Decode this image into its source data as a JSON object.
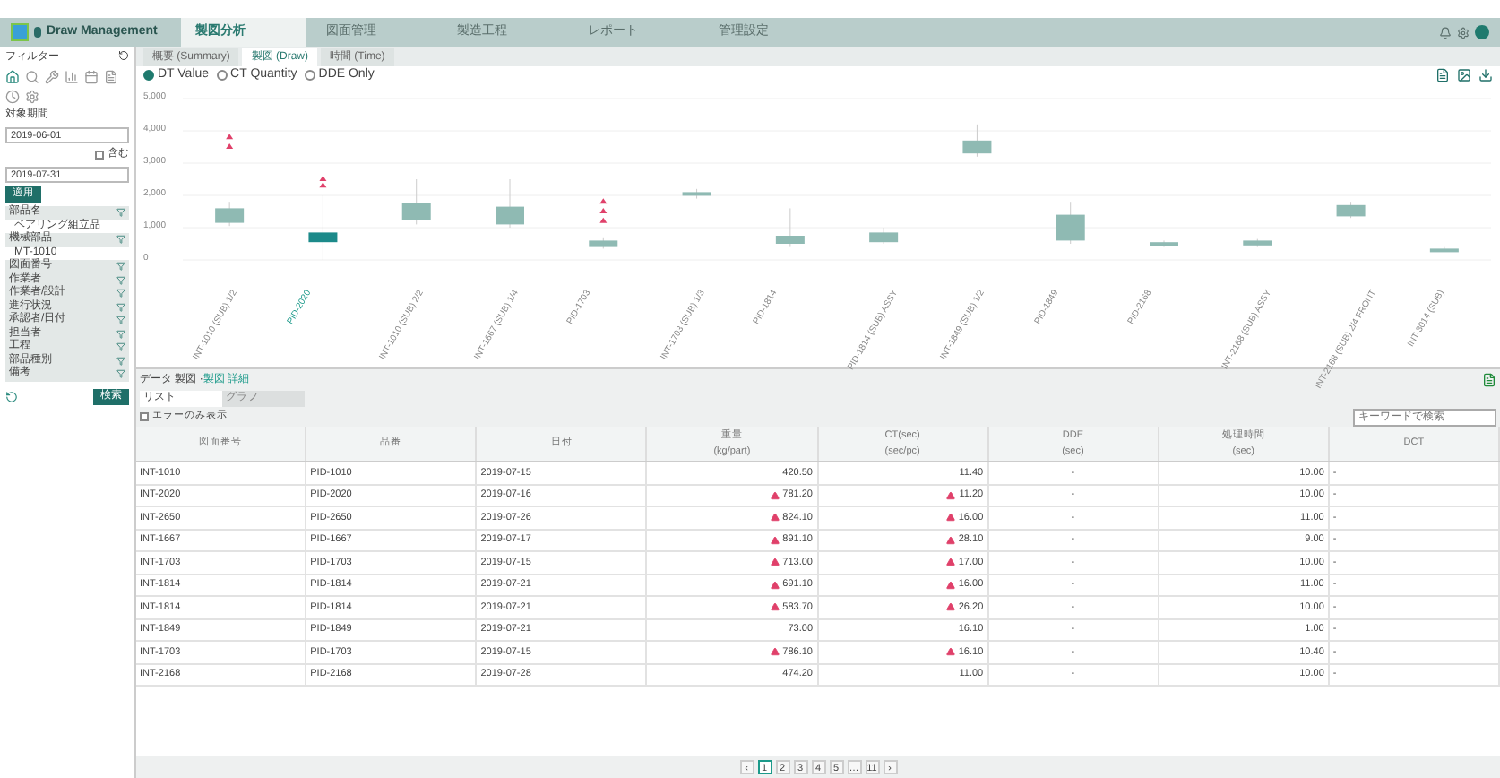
{
  "app": {
    "title": "Draw Management"
  },
  "top_tabs": [
    {
      "label": "製図分析",
      "selected": true
    },
    {
      "label": "図面管理",
      "selected": false
    },
    {
      "label": "製造工程",
      "selected": false
    },
    {
      "label": "レポート",
      "selected": false
    },
    {
      "label": "管理設定",
      "selected": false
    }
  ],
  "sub_tabs": [
    {
      "label": "概要 (Summary)",
      "selected": false
    },
    {
      "label": "製図 (Draw)",
      "selected": true
    },
    {
      "label": "時間 (Time)",
      "selected": false
    }
  ],
  "sidebar": {
    "title": "フィルター",
    "period_label": "対象期間",
    "date_from": "2019-06-01",
    "date_to": "2019-07-31",
    "include_label": "含む",
    "include_checked": false,
    "apply": "適用",
    "filters": [
      {
        "label": "部品名",
        "kind": "group"
      },
      {
        "label": "ベアリング組立品",
        "kind": "value"
      },
      {
        "label": "機械部品",
        "kind": "group"
      },
      {
        "label": "MT-1010",
        "kind": "value"
      },
      {
        "label": "図面番号",
        "kind": "group"
      },
      {
        "label": "作業者",
        "kind": "group"
      },
      {
        "label": "作業者/設計",
        "kind": "group"
      },
      {
        "label": "進行状況",
        "kind": "group"
      },
      {
        "label": "承認者/日付",
        "kind": "group"
      },
      {
        "label": "担当者",
        "kind": "group"
      },
      {
        "label": "工程",
        "kind": "group"
      },
      {
        "label": "部品種別",
        "kind": "group"
      },
      {
        "label": "備考",
        "kind": "group"
      }
    ],
    "search": "検索"
  },
  "radios": [
    {
      "label": "DT Value",
      "selected": true
    },
    {
      "label": "CT Quantity",
      "selected": false
    },
    {
      "label": "DDE Only",
      "selected": false
    }
  ],
  "chart": {
    "yticks": [
      "5,000",
      "4,000",
      "3,000",
      "2,000",
      "1,000",
      "0"
    ],
    "categories": [
      "INT-1010 (SUB) 1/2",
      "PID-2020",
      "INT-1010 (SUB) 2/2",
      "INT-1667 (SUB) 1/4",
      "PID-1703",
      "INT-1703 (SUB) 1/3",
      "PID-1814",
      "PID-1814 (SUB) ASSY",
      "INT-1849 (SUB) 1/2",
      "PID-1849",
      "PID-2168",
      "INT-2168 (SUB) ASSY",
      "INT-2168 (SUB) 2/4 FRONT",
      "INT-3014 (SUB)"
    ]
  },
  "detail": {
    "breadcrumb": "データ 製図 · ",
    "breadcrumb_link": "製図 詳細",
    "tabs": [
      {
        "label": "リスト",
        "selected": true
      },
      {
        "label": "グラフ",
        "selected": false
      }
    ],
    "show_errors": {
      "label": "エラーのみ表示",
      "checked": false
    },
    "search_placeholder": "キーワードで検索",
    "columns": [
      {
        "label": "図面番号"
      },
      {
        "label": "品番"
      },
      {
        "label": "日付"
      },
      {
        "label": "重量",
        "sub": "(kg/part)"
      },
      {
        "label": "CT(sec)",
        "sub": "(sec/pc)"
      },
      {
        "label": "DDE",
        "sub": "(sec)"
      },
      {
        "label": "処理時間",
        "sub": "(sec)"
      },
      {
        "label": "DCT"
      }
    ],
    "rows": [
      {
        "cells": [
          "INT-1010",
          "PID-1010",
          "2019-07-15",
          "420.50",
          "11.40",
          "-",
          "10.00",
          "-"
        ],
        "warn_a": false,
        "warn_b": false
      },
      {
        "cells": [
          "INT-2020",
          "PID-2020",
          "2019-07-16",
          "781.20",
          "11.20",
          "-",
          "10.00",
          "-"
        ],
        "warn_a": true,
        "warn_b": true
      },
      {
        "cells": [
          "INT-2650",
          "PID-2650",
          "2019-07-26",
          "824.10",
          "16.00",
          "-",
          "11.00",
          "-"
        ],
        "warn_a": true,
        "warn_b": true
      },
      {
        "cells": [
          "INT-1667",
          "PID-1667",
          "2019-07-17",
          "891.10",
          "28.10",
          "-",
          "9.00",
          "-"
        ],
        "warn_a": true,
        "warn_b": true
      },
      {
        "cells": [
          "INT-1703",
          "PID-1703",
          "2019-07-15",
          "713.00",
          "17.00",
          "-",
          "10.00",
          "-"
        ],
        "warn_a": true,
        "warn_b": true
      },
      {
        "cells": [
          "INT-1814",
          "PID-1814",
          "2019-07-21",
          "691.10",
          "16.00",
          "-",
          "11.00",
          "-"
        ],
        "warn_a": true,
        "warn_b": true
      },
      {
        "cells": [
          "INT-1814",
          "PID-1814",
          "2019-07-21",
          "583.70",
          "26.20",
          "-",
          "10.00",
          "-"
        ],
        "warn_a": true,
        "warn_b": true
      },
      {
        "cells": [
          "INT-1849",
          "PID-1849",
          "2019-07-21",
          "73.00",
          "16.10",
          "-",
          "1.00",
          "-"
        ],
        "warn_a": false,
        "warn_b": false
      },
      {
        "cells": [
          "INT-1703",
          "PID-1703",
          "2019-07-15",
          "786.10",
          "16.10",
          "-",
          "10.40",
          "-"
        ],
        "warn_a": true,
        "warn_b": true
      },
      {
        "cells": [
          "INT-2168",
          "PID-2168",
          "2019-07-28",
          "474.20",
          "11.00",
          "-",
          "10.00",
          "-"
        ],
        "warn_a": false,
        "warn_b": false
      }
    ],
    "pages": [
      {
        "label": "‹",
        "selected": false
      },
      {
        "label": "1",
        "selected": true
      },
      {
        "label": "2",
        "selected": false
      },
      {
        "label": "3",
        "selected": false
      },
      {
        "label": "4",
        "selected": false
      },
      {
        "label": "5",
        "selected": false
      },
      {
        "label": "…",
        "selected": false
      },
      {
        "label": "11",
        "selected": false
      },
      {
        "label": "›",
        "selected": false
      }
    ]
  }
}
